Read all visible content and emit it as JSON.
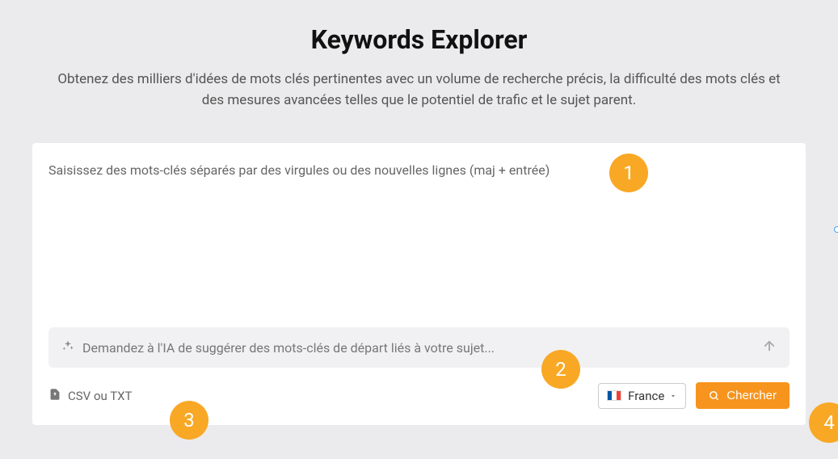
{
  "header": {
    "title": "Keywords Explorer",
    "subtitle": "Obtenez des milliers d'idées de mots clés pertinentes avec un volume de recherche précis, la difficulté des mots clés et des mesures avancées telles que le potentiel de trafic et le sujet parent."
  },
  "form": {
    "keywords_placeholder": "Saisissez des mots-clés séparés par des virgules ou des nouvelles lignes (maj + entrée)",
    "ai_placeholder": "Demandez à l'IA de suggérer des mots-clés de départ liés à votre sujet...",
    "upload_label": "CSV ou TXT",
    "country_label": "France",
    "search_label": "Chercher"
  },
  "annotations": {
    "a1": "1",
    "a2": "2",
    "a3": "3",
    "a4": "4"
  }
}
